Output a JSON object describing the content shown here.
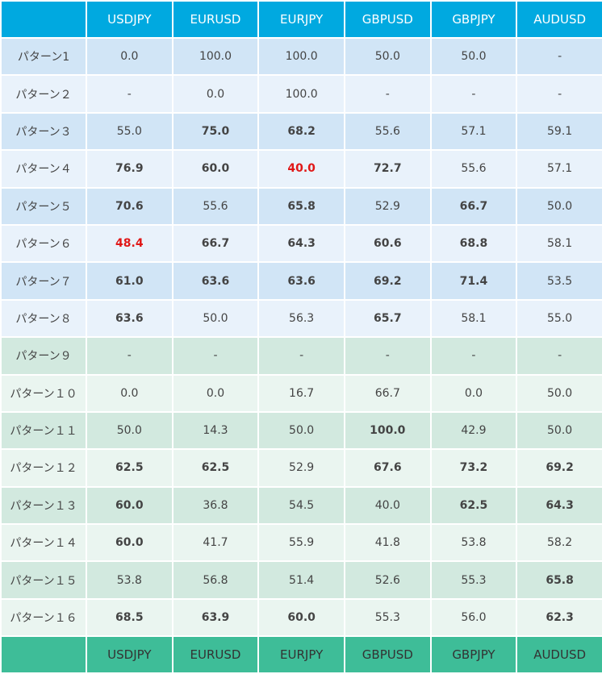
{
  "header": [
    "USDJPY",
    "EURUSD",
    "EURJPY",
    "GBPUSD",
    "GBPJPY",
    "AUDUSD"
  ],
  "footer": [
    "USDJPY",
    "EURUSD",
    "EURJPY",
    "GBPUSD",
    "GBPJPY",
    "AUDUSD"
  ],
  "colors": {
    "header_bg": "#00a9e0",
    "footer_bg": "#3ebd98",
    "blue_row_dark": "#d1e5f6",
    "blue_row_light": "#e9f2fb",
    "green_row_dark": "#d2e9df",
    "green_row_light": "#eaf5f0",
    "highlight_red": "#e53333"
  },
  "rows": [
    {
      "label": "パターン1",
      "group": "blue",
      "cells": [
        {
          "v": "0.0",
          "b": false,
          "r": false
        },
        {
          "v": "100.0",
          "b": false,
          "r": false
        },
        {
          "v": "100.0",
          "b": false,
          "r": false
        },
        {
          "v": "50.0",
          "b": false,
          "r": false
        },
        {
          "v": "50.0",
          "b": false,
          "r": false
        },
        {
          "v": "-",
          "b": false,
          "r": false
        }
      ]
    },
    {
      "label": "パターン２",
      "group": "blue",
      "cells": [
        {
          "v": "-",
          "b": false,
          "r": false
        },
        {
          "v": "0.0",
          "b": false,
          "r": false
        },
        {
          "v": "100.0",
          "b": false,
          "r": false
        },
        {
          "v": "-",
          "b": false,
          "r": false
        },
        {
          "v": "-",
          "b": false,
          "r": false
        },
        {
          "v": "-",
          "b": false,
          "r": false
        }
      ]
    },
    {
      "label": "パターン３",
      "group": "blue",
      "cells": [
        {
          "v": "55.0",
          "b": false,
          "r": false
        },
        {
          "v": "75.0",
          "b": true,
          "r": false
        },
        {
          "v": "68.2",
          "b": true,
          "r": false
        },
        {
          "v": "55.6",
          "b": false,
          "r": false
        },
        {
          "v": "57.1",
          "b": false,
          "r": false
        },
        {
          "v": "59.1",
          "b": false,
          "r": false
        }
      ]
    },
    {
      "label": "パターン４",
      "group": "blue",
      "cells": [
        {
          "v": "76.9",
          "b": true,
          "r": false
        },
        {
          "v": "60.0",
          "b": true,
          "r": false
        },
        {
          "v": "40.0",
          "b": true,
          "r": true
        },
        {
          "v": "72.7",
          "b": true,
          "r": false
        },
        {
          "v": "55.6",
          "b": false,
          "r": false
        },
        {
          "v": "57.1",
          "b": false,
          "r": false
        }
      ]
    },
    {
      "label": "パターン５",
      "group": "blue",
      "cells": [
        {
          "v": "70.6",
          "b": true,
          "r": false
        },
        {
          "v": "55.6",
          "b": false,
          "r": false
        },
        {
          "v": "65.8",
          "b": true,
          "r": false
        },
        {
          "v": "52.9",
          "b": false,
          "r": false
        },
        {
          "v": "66.7",
          "b": true,
          "r": false
        },
        {
          "v": "50.0",
          "b": false,
          "r": false
        }
      ]
    },
    {
      "label": "パターン６",
      "group": "blue",
      "cells": [
        {
          "v": "48.4",
          "b": true,
          "r": true
        },
        {
          "v": "66.7",
          "b": true,
          "r": false
        },
        {
          "v": "64.3",
          "b": true,
          "r": false
        },
        {
          "v": "60.6",
          "b": true,
          "r": false
        },
        {
          "v": "68.8",
          "b": true,
          "r": false
        },
        {
          "v": "58.1",
          "b": false,
          "r": false
        }
      ]
    },
    {
      "label": "パターン７",
      "group": "blue",
      "cells": [
        {
          "v": "61.0",
          "b": true,
          "r": false
        },
        {
          "v": "63.6",
          "b": true,
          "r": false
        },
        {
          "v": "63.6",
          "b": true,
          "r": false
        },
        {
          "v": "69.2",
          "b": true,
          "r": false
        },
        {
          "v": "71.4",
          "b": true,
          "r": false
        },
        {
          "v": "53.5",
          "b": false,
          "r": false
        }
      ]
    },
    {
      "label": "パターン８",
      "group": "blue",
      "cells": [
        {
          "v": "63.6",
          "b": true,
          "r": false
        },
        {
          "v": "50.0",
          "b": false,
          "r": false
        },
        {
          "v": "56.3",
          "b": false,
          "r": false
        },
        {
          "v": "65.7",
          "b": true,
          "r": false
        },
        {
          "v": "58.1",
          "b": false,
          "r": false
        },
        {
          "v": "55.0",
          "b": false,
          "r": false
        }
      ]
    },
    {
      "label": "パターン９",
      "group": "green",
      "cells": [
        {
          "v": "-",
          "b": false,
          "r": false
        },
        {
          "v": "-",
          "b": false,
          "r": false
        },
        {
          "v": "-",
          "b": false,
          "r": false
        },
        {
          "v": "-",
          "b": false,
          "r": false
        },
        {
          "v": "-",
          "b": false,
          "r": false
        },
        {
          "v": "-",
          "b": false,
          "r": false
        }
      ]
    },
    {
      "label": "パターン１０",
      "group": "green",
      "cells": [
        {
          "v": "0.0",
          "b": false,
          "r": false
        },
        {
          "v": "0.0",
          "b": false,
          "r": false
        },
        {
          "v": "16.7",
          "b": false,
          "r": false
        },
        {
          "v": "66.7",
          "b": false,
          "r": false
        },
        {
          "v": "0.0",
          "b": false,
          "r": false
        },
        {
          "v": "50.0",
          "b": false,
          "r": false
        }
      ]
    },
    {
      "label": "パターン１１",
      "group": "green",
      "cells": [
        {
          "v": "50.0",
          "b": false,
          "r": false
        },
        {
          "v": "14.3",
          "b": false,
          "r": true
        },
        {
          "v": "50.0",
          "b": false,
          "r": false
        },
        {
          "v": "100.0",
          "b": true,
          "r": false
        },
        {
          "v": "42.9",
          "b": false,
          "r": true
        },
        {
          "v": "50.0",
          "b": false,
          "r": false
        }
      ]
    },
    {
      "label": "パターン１２",
      "group": "green",
      "cells": [
        {
          "v": "62.5",
          "b": true,
          "r": false
        },
        {
          "v": "62.5",
          "b": true,
          "r": false
        },
        {
          "v": "52.9",
          "b": false,
          "r": false
        },
        {
          "v": "67.6",
          "b": true,
          "r": false
        },
        {
          "v": "73.2",
          "b": true,
          "r": false
        },
        {
          "v": "69.2",
          "b": true,
          "r": false
        }
      ]
    },
    {
      "label": "パターン１３",
      "group": "green",
      "cells": [
        {
          "v": "60.0",
          "b": true,
          "r": false
        },
        {
          "v": "36.8",
          "b": false,
          "r": true
        },
        {
          "v": "54.5",
          "b": false,
          "r": false
        },
        {
          "v": "40.0",
          "b": false,
          "r": true
        },
        {
          "v": "62.5",
          "b": true,
          "r": false
        },
        {
          "v": "64.3",
          "b": true,
          "r": false
        }
      ]
    },
    {
      "label": "パターン１４",
      "group": "green",
      "cells": [
        {
          "v": "60.0",
          "b": true,
          "r": false
        },
        {
          "v": "41.7",
          "b": false,
          "r": true
        },
        {
          "v": "55.9",
          "b": false,
          "r": false
        },
        {
          "v": "41.8",
          "b": false,
          "r": true
        },
        {
          "v": "53.8",
          "b": false,
          "r": false
        },
        {
          "v": "58.2",
          "b": false,
          "r": false
        }
      ]
    },
    {
      "label": "パターン１５",
      "group": "green",
      "cells": [
        {
          "v": "53.8",
          "b": false,
          "r": false
        },
        {
          "v": "56.8",
          "b": false,
          "r": false
        },
        {
          "v": "51.4",
          "b": false,
          "r": false
        },
        {
          "v": "52.6",
          "b": false,
          "r": false
        },
        {
          "v": "55.3",
          "b": false,
          "r": false
        },
        {
          "v": "65.8",
          "b": true,
          "r": false
        }
      ]
    },
    {
      "label": "パターン１６",
      "group": "green",
      "cells": [
        {
          "v": "68.5",
          "b": true,
          "r": false
        },
        {
          "v": "63.9",
          "b": true,
          "r": false
        },
        {
          "v": "60.0",
          "b": true,
          "r": false
        },
        {
          "v": "55.3",
          "b": false,
          "r": false
        },
        {
          "v": "56.0",
          "b": false,
          "r": false
        },
        {
          "v": "62.3",
          "b": true,
          "r": false
        }
      ]
    }
  ]
}
